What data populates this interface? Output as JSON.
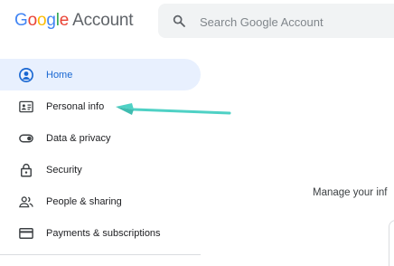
{
  "header": {
    "logo": {
      "g": "G",
      "o1": "o",
      "o2": "o",
      "g2": "g",
      "l": "l",
      "e": "e",
      "account": "Account"
    },
    "search": {
      "placeholder": "Search Google Account"
    }
  },
  "sidebar": {
    "items": [
      {
        "label": "Home",
        "icon": "home-account-icon",
        "active": true
      },
      {
        "label": "Personal info",
        "icon": "id-card-icon",
        "active": false
      },
      {
        "label": "Data & privacy",
        "icon": "toggle-icon",
        "active": false
      },
      {
        "label": "Security",
        "icon": "lock-icon",
        "active": false
      },
      {
        "label": "People & sharing",
        "icon": "people-icon",
        "active": false
      },
      {
        "label": "Payments & subscriptions",
        "icon": "credit-card-icon",
        "active": false
      }
    ]
  },
  "main": {
    "manage_text": "Manage your inf"
  },
  "colors": {
    "accent": "#1a73e8",
    "active_bg": "#e8f0fe",
    "arrow": "#4fd1c5"
  }
}
